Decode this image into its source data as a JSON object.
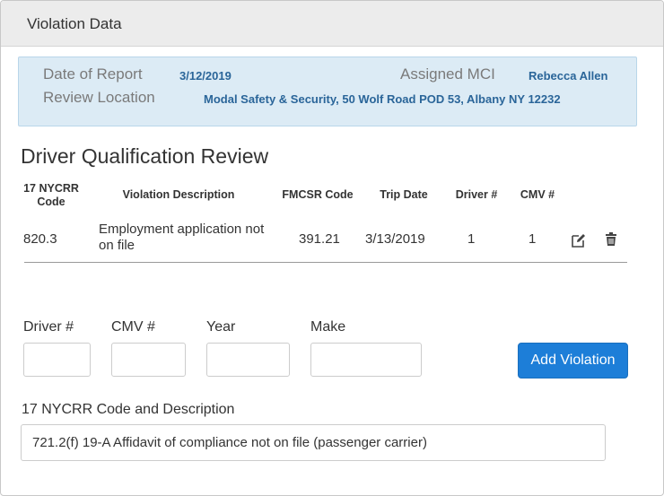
{
  "panel": {
    "title": "Violation Data"
  },
  "report": {
    "date_label": "Date of Report",
    "date_value": "3/12/2019",
    "mci_label": "Assigned MCI",
    "mci_value": "Rebecca Allen",
    "location_label": "Review Location",
    "location_value": "Modal Safety & Security, 50 Wolf Road POD 53, Albany NY 12232"
  },
  "section": {
    "title": "Driver Qualification Review"
  },
  "table": {
    "headers": [
      "17 NYCRR\nCode",
      "Violation Description",
      "FMCSR Code",
      "Trip Date",
      "Driver #",
      "CMV #"
    ],
    "rows": [
      {
        "code": "820.3",
        "description": "Employment application not on file",
        "fmcsr": "391.21",
        "trip_date": "3/13/2019",
        "driver": "1",
        "cmv": "1"
      }
    ],
    "icons": {
      "edit": "edit-icon",
      "delete": "trash-icon"
    }
  },
  "form": {
    "driver_label": "Driver #",
    "cmv_label": "CMV #",
    "year_label": "Year",
    "make_label": "Make",
    "driver_value": "",
    "cmv_value": "",
    "year_value": "",
    "make_value": "",
    "add_button": "Add Violation",
    "code_label": "17 NYCRR Code and Description",
    "code_value": "721.2(f) 19-A Affidavit of compliance not on file (passenger carrier)"
  },
  "colors": {
    "accent": "#1d7ed8",
    "info_bg": "#dcebf5",
    "info_value": "#2a6599",
    "header_bg": "#ececec"
  }
}
